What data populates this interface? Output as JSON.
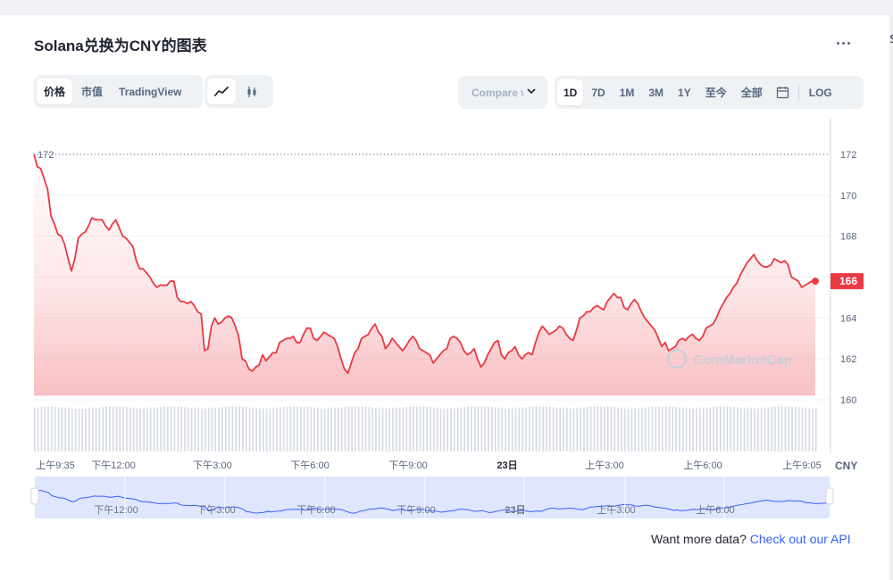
{
  "title": "Solana兑换为CNY的图表",
  "menu_icon": "more-horizontal-icon",
  "edge_glyph": "$",
  "view_tabs": [
    {
      "label": "价格",
      "active": true
    },
    {
      "label": "市值",
      "active": false
    },
    {
      "label": "TradingView",
      "active": false
    }
  ],
  "chart_type_icons": [
    {
      "name": "line-chart-icon",
      "active": true
    },
    {
      "name": "candlestick-icon",
      "active": false
    }
  ],
  "compare": {
    "label": "Compare w"
  },
  "ranges": [
    {
      "label": "1D",
      "active": true
    },
    {
      "label": "7D",
      "active": false
    },
    {
      "label": "1M",
      "active": false
    },
    {
      "label": "3M",
      "active": false
    },
    {
      "label": "1Y",
      "active": false
    },
    {
      "label": "至今",
      "active": false
    },
    {
      "label": "全部",
      "active": false
    }
  ],
  "calendar_icon": "calendar-icon",
  "log_label": "LOG",
  "colors": {
    "line": "#ea3943",
    "fill_top": "#ea3943",
    "volume": "#d6dae3",
    "nav_fill": "#dfe6fd",
    "nav_line": "#3861fb",
    "accent": "#3861fb"
  },
  "watermark": "CoinMarketCap",
  "currency_label": "CNY",
  "footer": {
    "text": "Want more data?",
    "link": "Check out our API"
  },
  "chart_data": {
    "type": "line",
    "x_tick_labels": [
      "上午9:35",
      "下午12:00",
      "下午3:00",
      "下午6:00",
      "下午9:00",
      "23日",
      "上午3:00",
      "上午6:00",
      "上午9:05"
    ],
    "y_ticks": [
      160,
      162,
      164,
      166,
      168,
      170,
      172
    ],
    "ylim": [
      158.5,
      173.5
    ],
    "high_label": "172",
    "current_label": "166",
    "current_value": 165.8,
    "navigator_labels": [
      "下午12:00",
      "下午3:00",
      "下午6:00",
      "下午9:00",
      "23日",
      "上午3:00",
      "上午6:00"
    ],
    "grid": true,
    "x": [
      0,
      1,
      2,
      3,
      4,
      5,
      6,
      7,
      8,
      9,
      10,
      11,
      12,
      13,
      14,
      15,
      16,
      17,
      18,
      19,
      20,
      21,
      22,
      23,
      24,
      25,
      26,
      27,
      28,
      29,
      30,
      31,
      32,
      33,
      34,
      35,
      36,
      37,
      38,
      39,
      40,
      41,
      42,
      43,
      44,
      45,
      46,
      47,
      48,
      49,
      50,
      51,
      52,
      53,
      54,
      55,
      56,
      57,
      58,
      59,
      60,
      61,
      62,
      63,
      64,
      65,
      66,
      67,
      68,
      69,
      70,
      71,
      72,
      73,
      74,
      75,
      76,
      77,
      78,
      79,
      80,
      81,
      82,
      83,
      84,
      85,
      86,
      87,
      88,
      89,
      90,
      91,
      92,
      93,
      94,
      95,
      96,
      97,
      98,
      99,
      100,
      101,
      102,
      103,
      104,
      105,
      106,
      107,
      108,
      109,
      110,
      111,
      112,
      113,
      114,
      115,
      116,
      117,
      118,
      119,
      120,
      121,
      122,
      123,
      124,
      125,
      126,
      127,
      128,
      129,
      130,
      131,
      132,
      133,
      134,
      135,
      136,
      137,
      138,
      139,
      140,
      141,
      142,
      143,
      144,
      145,
      146,
      147,
      148,
      149,
      150,
      151,
      152,
      153,
      154,
      155,
      156,
      157,
      158,
      159,
      160,
      161,
      162,
      163,
      164,
      165,
      166,
      167,
      168,
      169,
      170,
      171,
      172,
      173,
      174,
      175,
      176,
      177,
      178,
      179,
      180,
      181,
      182,
      183,
      184,
      185,
      186,
      187,
      188,
      189,
      190,
      191,
      192,
      193,
      194,
      195,
      196,
      197,
      198,
      199,
      200,
      201,
      202,
      203,
      204,
      205,
      206,
      207,
      208,
      209,
      210,
      211,
      212,
      213,
      214,
      215,
      216,
      217,
      218,
      219,
      220,
      221,
      222,
      223,
      224,
      225,
      226,
      227,
      228,
      229,
      230,
      231,
      232,
      233,
      234,
      235,
      236,
      237,
      238,
      239,
      240,
      241,
      242,
      243,
      244,
      245,
      246,
      247,
      248,
      249,
      250,
      251,
      252,
      253,
      254,
      255,
      256,
      257,
      258,
      259,
      260,
      261,
      262,
      263,
      264,
      265,
      266,
      267,
      268,
      269,
      270,
      271,
      272,
      273,
      274,
      275,
      276,
      277,
      278,
      279,
      280,
      281,
      282,
      283,
      284,
      285,
      286,
      287
    ],
    "series": [
      {
        "values": [
          172.0,
          171.4,
          171.3,
          170.8,
          170.3,
          169.0,
          168.6,
          168.1,
          168.0,
          167.6,
          166.9,
          166.3,
          166.9,
          167.9,
          168.1,
          168.2,
          168.5,
          168.9,
          168.8,
          168.8,
          168.8,
          168.5,
          168.3,
          168.6,
          168.8,
          168.4,
          168.0,
          167.9,
          167.7,
          167.5,
          166.8,
          166.4,
          166.4,
          166.2,
          166.0,
          165.7,
          165.5,
          165.6,
          165.6,
          165.6,
          165.8,
          165.8,
          165.0,
          164.8,
          164.8,
          164.7,
          164.8,
          164.6,
          164.3,
          164.2,
          162.4,
          162.5,
          163.6,
          164.0,
          163.7,
          163.8,
          164.0,
          164.1,
          164.0,
          163.6,
          163.1,
          162.0,
          161.9,
          161.5,
          161.4,
          161.6,
          161.7,
          162.2,
          161.9,
          162.1,
          162.3,
          162.3,
          162.8,
          162.9,
          163.0,
          163.0,
          163.1,
          162.8,
          162.8,
          163.2,
          163.5,
          163.5,
          163.0,
          162.9,
          163.1,
          163.3,
          163.2,
          163.1,
          163.0,
          162.6,
          162.0,
          161.5,
          161.3,
          161.8,
          162.3,
          162.5,
          163.0,
          163.1,
          163.2,
          163.5,
          163.7,
          163.3,
          163.1,
          162.5,
          162.7,
          163.0,
          162.8,
          162.6,
          162.4,
          162.6,
          162.9,
          163.1,
          162.9,
          162.5,
          162.4,
          162.3,
          162.2,
          161.8,
          162.0,
          162.2,
          162.4,
          162.5,
          163.0,
          163.1,
          163.0,
          162.8,
          162.4,
          162.2,
          162.3,
          162.5,
          162.0,
          161.6,
          161.8,
          162.2,
          162.5,
          162.8,
          162.9,
          162.2,
          162.0,
          162.3,
          162.4,
          162.6,
          162.2,
          162.0,
          162.2,
          162.3,
          162.2,
          162.8,
          163.3,
          163.6,
          163.4,
          163.2,
          163.3,
          163.4,
          163.6,
          163.5,
          163.2,
          163.0,
          162.9,
          163.4,
          164.0,
          164.1,
          164.3,
          164.3,
          164.5,
          164.6,
          164.5,
          164.4,
          164.8,
          165.0,
          165.2,
          165.0,
          165.0,
          164.5,
          164.4,
          164.7,
          164.9,
          164.7,
          164.3,
          164.0,
          163.8,
          163.6,
          163.4,
          163.0,
          162.6,
          162.8,
          162.4,
          162.5,
          162.6,
          162.9,
          163.0,
          162.9,
          163.1,
          163.2,
          163.0,
          162.9,
          163.1,
          163.5,
          163.6,
          163.7,
          164.0,
          164.4,
          164.7,
          165.0,
          165.2,
          165.5,
          165.7,
          166.1,
          166.4,
          166.7,
          166.9,
          167.1,
          166.8,
          166.6,
          166.5,
          166.5,
          166.6,
          166.9,
          166.8,
          166.7,
          166.8,
          166.6,
          166.0,
          165.9,
          165.8,
          165.5,
          165.6,
          165.7,
          165.8,
          165.8
        ]
      }
    ]
  }
}
